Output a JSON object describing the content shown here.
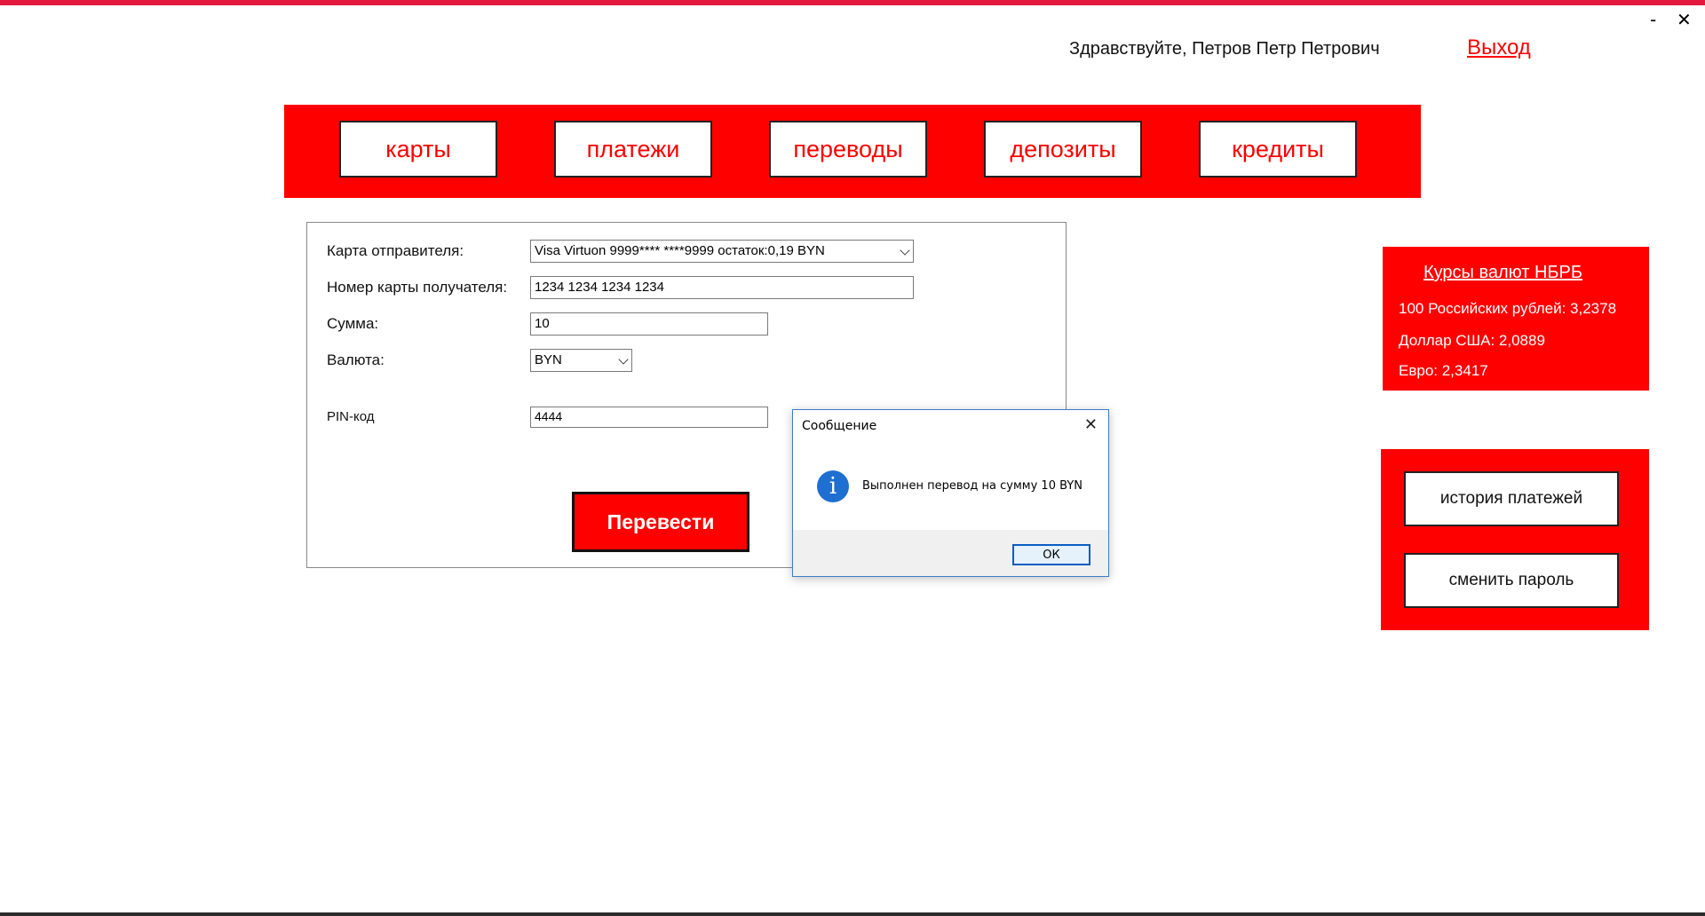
{
  "header": {
    "greeting": "Здравствуйте, Петров Петр Петрович",
    "logout": "Выход",
    "minimize": "-",
    "close": "✕"
  },
  "nav": {
    "items": [
      {
        "label": "карты"
      },
      {
        "label": "платежи"
      },
      {
        "label": "переводы"
      },
      {
        "label": "депозиты"
      },
      {
        "label": "кредиты"
      }
    ]
  },
  "form": {
    "sender_label": "Карта отправителя:",
    "sender_value": "Visa Virtuon 9999**** ****9999 остаток:0,19 BYN",
    "receiver_label": "Номер карты получателя:",
    "receiver_value": "1234 1234 1234 1234",
    "amount_label": "Сумма:",
    "amount_value": "10",
    "currency_label": "Валюта:",
    "currency_value": "BYN",
    "pin_label": "PIN-код",
    "pin_value": "4444",
    "submit": "Перевести"
  },
  "rates": {
    "title": "Курсы валют НБРБ",
    "items": [
      "100 Российских рублей: 3,2378",
      "Доллар США: 2,0889",
      "Евро: 2,3417"
    ]
  },
  "side": {
    "history": "история платежей",
    "change_password": "сменить пароль"
  },
  "dialog": {
    "title": "Сообщение",
    "close": "✕",
    "icon": "info-icon",
    "message": "Выполнен перевод на сумму 10 BYN",
    "ok": "ОК"
  },
  "colors": {
    "accent": "#ff0000",
    "topline": "#e2193e",
    "dialog_border": "#3d7cc9"
  }
}
